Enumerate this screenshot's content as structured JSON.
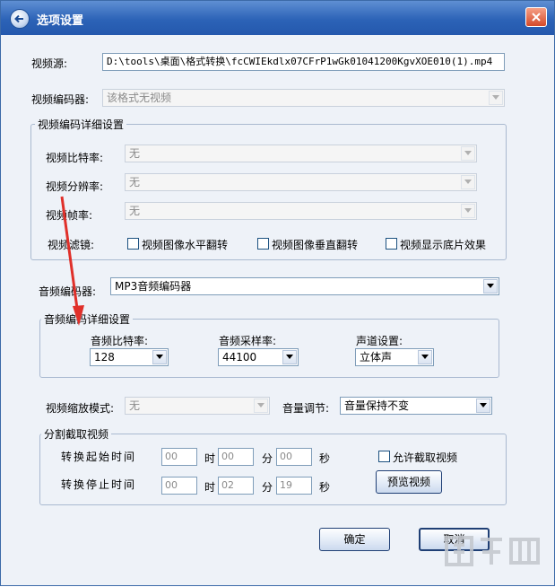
{
  "window": {
    "title": "选项设置"
  },
  "video_source": {
    "label": "视频源:",
    "value": "D:\\tools\\桌面\\格式转换\\fcCWIEkdlx07CFrP1wGk01041200KgvXOE010(1).mp4"
  },
  "video_encoder": {
    "label": "视频编码器:",
    "value": "该格式无视频"
  },
  "video_detail": {
    "title": "视频编码详细设置",
    "bitrate": {
      "label": "视频比特率:",
      "value": "无"
    },
    "resolution": {
      "label": "视频分辨率:",
      "value": "无"
    },
    "framerate": {
      "label": "视频帧率:",
      "value": "无"
    },
    "filter": {
      "label": "视频滤镜:",
      "options": [
        "视频图像水平翻转",
        "视频图像垂直翻转",
        "视频显示底片效果"
      ]
    }
  },
  "audio_encoder": {
    "label": "音频编码器:",
    "value": "MP3音频编码器"
  },
  "audio_detail": {
    "title": "音频编码详细设置",
    "bitrate": {
      "label": "音频比特率:",
      "value": "128"
    },
    "samplerate": {
      "label": "音频采样率:",
      "value": "44100"
    },
    "channels": {
      "label": "声道设置:",
      "value": "立体声"
    }
  },
  "scale_mode": {
    "label": "视频缩放模式:",
    "value": "无"
  },
  "volume": {
    "label": "音量调节:",
    "value": "音量保持不变"
  },
  "split": {
    "title": "分割截取视频",
    "start": {
      "label": "转换起始时间",
      "h": "00",
      "m": "00",
      "s": "00"
    },
    "end": {
      "label": "转换停止时间",
      "h": "00",
      "m": "02",
      "s": "19"
    },
    "unit_h": "时",
    "unit_m": "分",
    "unit_s": "秒",
    "allow_label": "允许截取视频",
    "preview_label": "预览视频"
  },
  "buttons": {
    "ok": "确定",
    "cancel": "取消"
  },
  "watermark": "下载吧",
  "colors": {
    "titlebar": "#2c63b7",
    "annotation_arrow": "#e0302a"
  }
}
